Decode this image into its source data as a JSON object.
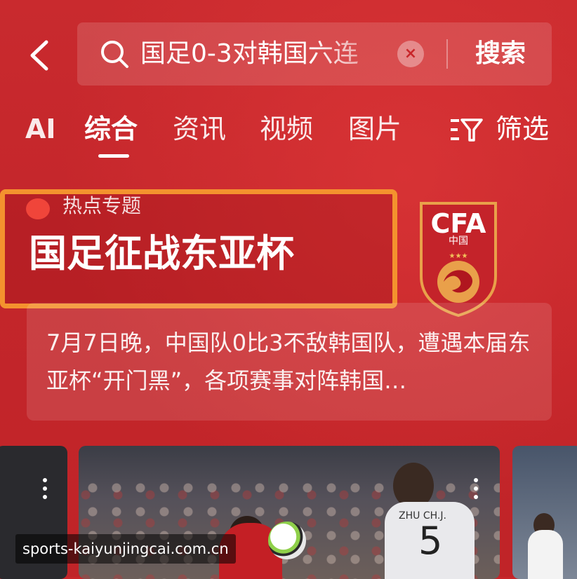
{
  "search": {
    "query": "国足0-3对韩国六连",
    "button_label": "搜索"
  },
  "tabs": [
    {
      "label": "AI",
      "active": false
    },
    {
      "label": "综合",
      "active": true
    },
    {
      "label": "资讯",
      "active": false
    },
    {
      "label": "视频",
      "active": false
    },
    {
      "label": "图片",
      "active": false
    }
  ],
  "filter": {
    "label": "筛选"
  },
  "topic": {
    "tag": "热点专题",
    "title": "国足征战东亚杯",
    "badge": {
      "letters": "CFA",
      "subtitle": "中国"
    }
  },
  "summary": {
    "text": "7月7日晚，中国队0比3不敌韩国队，遭遇本届东亚杯“开门黑”，各项赛事对阵韩国…"
  },
  "media": {
    "jersey_name": "ZHU CH.J.",
    "jersey_number": "5"
  },
  "watermark": "sports-kaiyunjingcai.com.cn",
  "colors": {
    "background": "#c8262a",
    "highlight_border": "#f4922e",
    "hot_dot": "#f0453a"
  }
}
